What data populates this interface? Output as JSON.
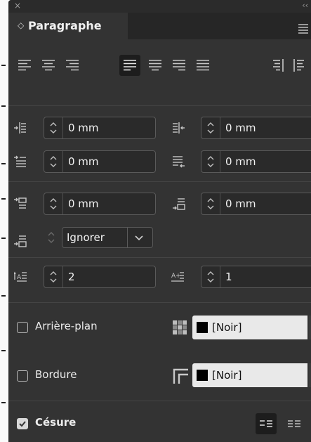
{
  "panel": {
    "tab_chevron": "◇",
    "tab_title": "Paragraphe",
    "close_glyph": "×",
    "collapse_glyph": "‹‹"
  },
  "alignment": {
    "buttons": [
      {
        "name": "align-left",
        "active": false
      },
      {
        "name": "align-center",
        "active": false
      },
      {
        "name": "align-right",
        "active": false
      },
      {
        "name": "justify-left",
        "active": true
      },
      {
        "name": "justify-center",
        "active": false
      },
      {
        "name": "justify-right",
        "active": false
      },
      {
        "name": "justify-all",
        "active": false
      },
      {
        "name": "align-towards-spine",
        "active": false
      },
      {
        "name": "align-away-from-spine",
        "active": false
      }
    ]
  },
  "indents": {
    "left_indent": "0 mm",
    "right_indent": "0 mm",
    "first_line_indent": "0 mm",
    "last_line_right_indent": "0 mm"
  },
  "spacing": {
    "space_before": "0 mm",
    "space_after": "0 mm",
    "align_to_grid": "Ignorer"
  },
  "dropcap": {
    "lines": "2",
    "characters": "1"
  },
  "shading": {
    "label": "Arrière-plan",
    "checked": false,
    "color": "[Noir]"
  },
  "border": {
    "label": "Bordure",
    "checked": false,
    "color": "[Noir]"
  },
  "hyphenation": {
    "label": "Césure",
    "checked": true
  },
  "colors": {
    "panel_bg": "#333333",
    "field_bg": "#2a2a2a",
    "active_button": "#1d1d1d",
    "swatch_bg": "#e9e9e9"
  }
}
